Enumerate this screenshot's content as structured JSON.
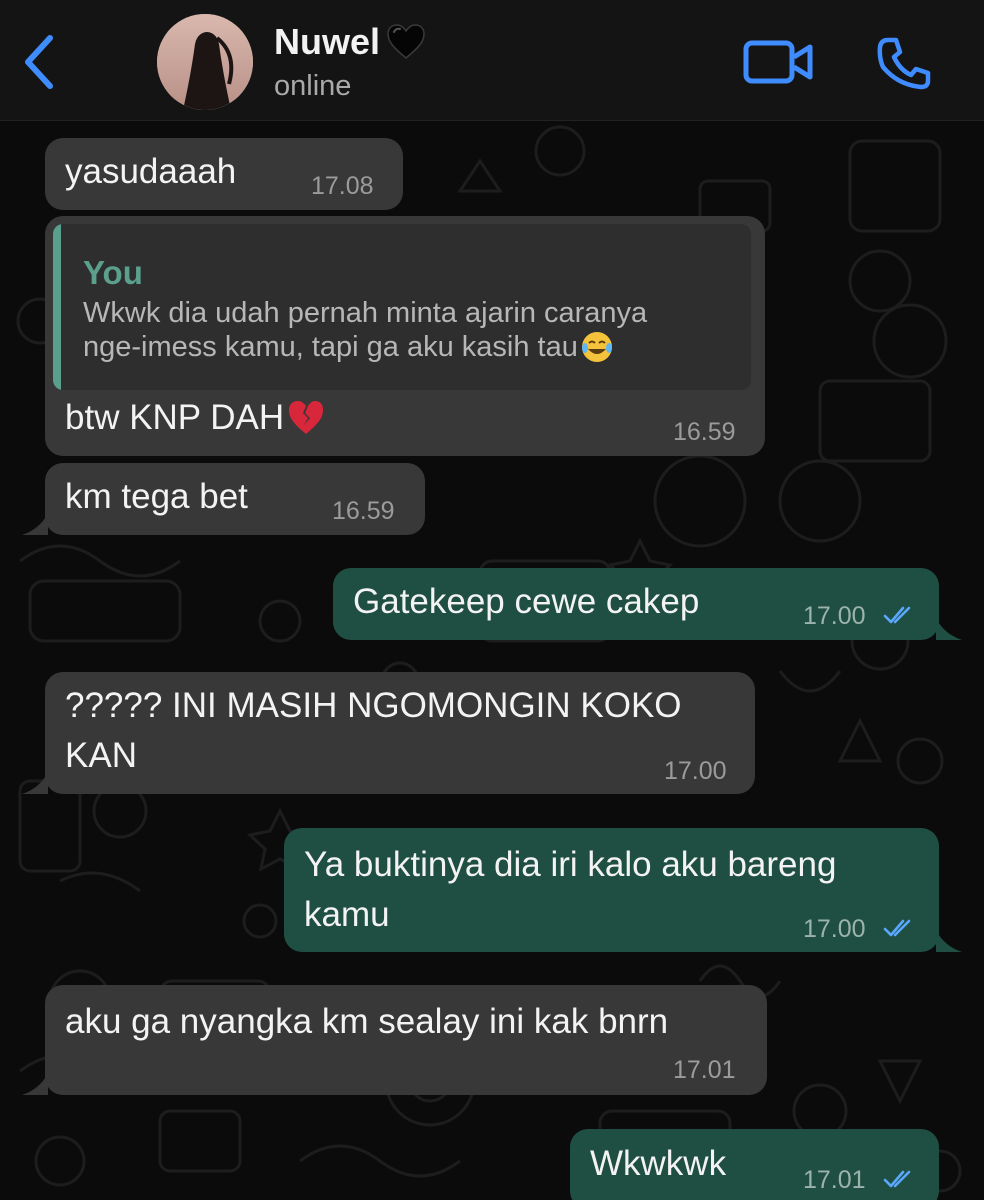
{
  "header": {
    "contact_name": "Nuwel",
    "status": "online",
    "name_emoji_icon": "black-heart-icon",
    "back_icon": "chevron-left-icon",
    "video_icon": "video-camera-icon",
    "call_icon": "phone-icon",
    "accent_color": "#3f8cff"
  },
  "messages": [
    {
      "direction": "incoming",
      "text": "yasudaaah",
      "time": "17.08"
    },
    {
      "direction": "incoming",
      "reply_to": {
        "author": "You",
        "line1": "Wkwk dia udah pernah minta ajarin caranya",
        "line2": "nge-imess kamu, tapi ga aku kasih tau",
        "emoji": "tears-of-joy-icon"
      },
      "text": "btw KNP DAH",
      "emoji": "broken-heart-icon",
      "time": "16.59"
    },
    {
      "direction": "incoming",
      "text": "km tega bet",
      "time": "16.59"
    },
    {
      "direction": "outgoing",
      "text": "Gatekeep cewe cakep",
      "time": "17.00",
      "status": "read"
    },
    {
      "direction": "incoming",
      "line1": "????? INI MASIH NGOMONGIN KOKO",
      "line2": "KAN",
      "time": "17.00"
    },
    {
      "direction": "outgoing",
      "line1": "Ya buktinya dia iri kalo aku bareng",
      "line2": "kamu",
      "time": "17.00",
      "status": "read"
    },
    {
      "direction": "incoming",
      "text": "aku ga nyangka km sealay ini kak bnrn",
      "time": "17.01"
    },
    {
      "direction": "outgoing",
      "text": "Wkwkwk",
      "time": "17.01",
      "status": "read"
    }
  ],
  "colors": {
    "incoming_bubble": "#383838",
    "outgoing_bubble": "#1f4f42",
    "read_ticks": "#5aa8ff",
    "reply_accent": "#5ba08c"
  }
}
